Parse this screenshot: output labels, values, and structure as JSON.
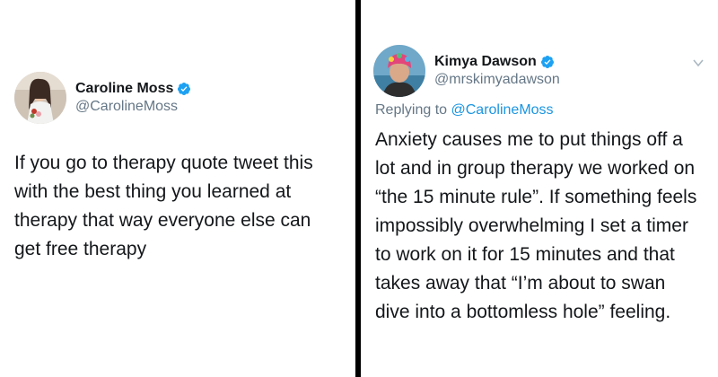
{
  "left_tweet": {
    "display_name": "Caroline Moss",
    "handle": "@CarolineMoss",
    "lines": [
      "If you go to therapy quote tweet this",
      "with the best thing you learned at",
      "therapy that way everyone else can",
      "get free therapy"
    ]
  },
  "right_tweet": {
    "display_name": "Kimya Dawson",
    "handle": "@mrskimyadawson",
    "replying_prefix": "Replying to ",
    "replying_mention": "@CarolineMoss",
    "lines": [
      "Anxiety causes me to put things off a",
      "lot and in group therapy we worked on",
      "“the 15 minute rule”. If something feels",
      "impossibly overwhelming I set a timer",
      "to work on it for 15 minutes and that",
      "takes away that “I’m about to swan",
      "dive into a bottomless hole” feeling."
    ]
  },
  "colors": {
    "verified_blue": "#1da1f2",
    "link_blue": "#1b95e0",
    "secondary_text": "#657786",
    "divider": "#000000"
  },
  "icons": {
    "verified": "verified-badge-icon",
    "caret": "chevron-down-icon"
  }
}
